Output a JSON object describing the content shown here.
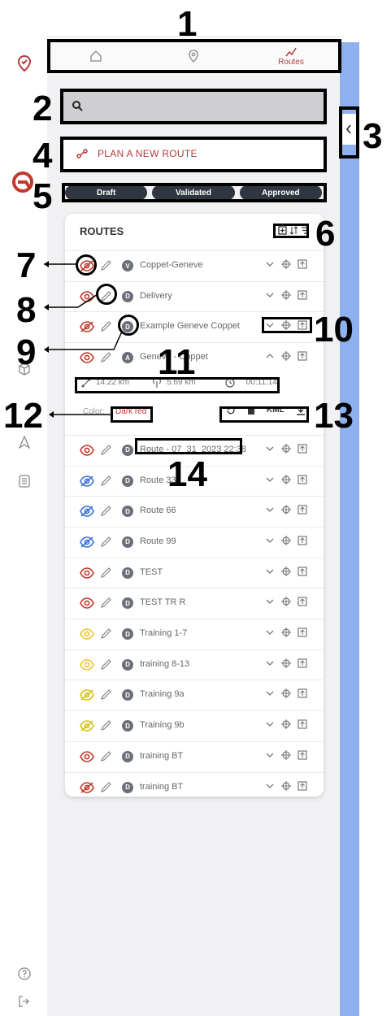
{
  "annotations": [
    "1",
    "2",
    "3",
    "4",
    "5",
    "6",
    "7",
    "8",
    "9",
    "10",
    "11",
    "12",
    "13",
    "14"
  ],
  "nav": {
    "tabs": [
      {
        "label": "",
        "icon": "home-icon"
      },
      {
        "label": "",
        "icon": "location-pin-icon"
      },
      {
        "label": "Routes",
        "icon": "route-icon"
      }
    ]
  },
  "search": {
    "placeholder": ""
  },
  "plan_label": "PLAN A NEW ROUTE",
  "status_filters": [
    "Draft",
    "Validated",
    "Approved"
  ],
  "routes_title": "ROUTES",
  "routes": [
    {
      "name": "Coppet-Geneve",
      "badge": "V",
      "eye": "#c0392b",
      "hidden": true,
      "expanded": false
    },
    {
      "name": "Delivery",
      "badge": "D",
      "eye": "#c0392b",
      "hidden": false,
      "expanded": false
    },
    {
      "name": "Example Geneve Coppet",
      "badge": "D",
      "eye": "#c0392b",
      "hidden": true,
      "expanded": false
    },
    {
      "name": "Geneve - Coppet",
      "badge": "A",
      "eye": "#c0392b",
      "hidden": false,
      "expanded": true
    },
    {
      "name": "Route - 07_31_2023 22:38",
      "badge": "D",
      "eye": "#c0392b",
      "hidden": false,
      "expanded": false
    },
    {
      "name": "Route 33",
      "badge": "D",
      "eye": "#3a6fd8",
      "hidden": true,
      "expanded": false
    },
    {
      "name": "Route 66",
      "badge": "D",
      "eye": "#3a6fd8",
      "hidden": true,
      "expanded": false
    },
    {
      "name": "Route 99",
      "badge": "D",
      "eye": "#3a6fd8",
      "hidden": true,
      "expanded": false
    },
    {
      "name": "TEST",
      "badge": "D",
      "eye": "#c0392b",
      "hidden": false,
      "expanded": false
    },
    {
      "name": "TEST TR R",
      "badge": "D",
      "eye": "#c0392b",
      "hidden": false,
      "expanded": false
    },
    {
      "name": "Training 1-7",
      "badge": "D",
      "eye": "#f1c232",
      "hidden": false,
      "expanded": false
    },
    {
      "name": "training 8-13",
      "badge": "D",
      "eye": "#f1c232",
      "hidden": false,
      "expanded": false
    },
    {
      "name": "Training 9a",
      "badge": "D",
      "eye": "#d4c21a",
      "hidden": true,
      "expanded": false
    },
    {
      "name": "Training 9b",
      "badge": "D",
      "eye": "#d4c21a",
      "hidden": true,
      "expanded": false
    },
    {
      "name": "training BT",
      "badge": "D",
      "eye": "#c0392b",
      "hidden": false,
      "expanded": false
    },
    {
      "name": "training BT",
      "badge": "D",
      "eye": "#c0392b",
      "hidden": true,
      "expanded": false
    }
  ],
  "expanded_details": {
    "distance": "14.22 km",
    "radio_distance": "5.69 km",
    "duration": "00:11:14",
    "color_label": "Color:",
    "color_value": "Dark red",
    "kml_label": "KML"
  },
  "colors": {
    "accent": "#b83a3a",
    "panel": "#f1f1f3",
    "strip": "#8fb0ee"
  }
}
